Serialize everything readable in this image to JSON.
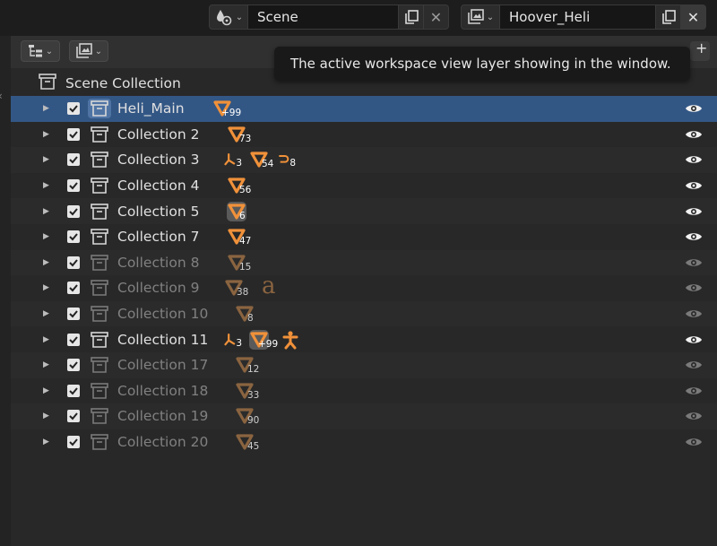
{
  "topbar": {
    "scene_name": "Scene",
    "view_layer_name": "Hoover_Heli"
  },
  "tooltip": "The active workspace view layer showing in the window.",
  "outliner": {
    "root_label": "Scene Collection",
    "rows": [
      {
        "label": "Heli_Main",
        "selected": true,
        "dim": false,
        "content": [
          {
            "type": "mesh",
            "count": "+99"
          }
        ]
      },
      {
        "label": "Collection 2",
        "selected": false,
        "dim": false,
        "content": [
          {
            "type": "mesh",
            "count": "73"
          }
        ]
      },
      {
        "label": "Collection 3",
        "selected": false,
        "dim": false,
        "content": [
          {
            "type": "bone",
            "count": "3"
          },
          {
            "type": "mesh",
            "count": "54"
          },
          {
            "type": "curve",
            "count": "8"
          }
        ]
      },
      {
        "label": "Collection 4",
        "selected": false,
        "dim": false,
        "content": [
          {
            "type": "mesh",
            "count": "56"
          }
        ]
      },
      {
        "label": "Collection 5",
        "selected": false,
        "dim": false,
        "content": [
          {
            "type": "mesh",
            "count": "6",
            "highlight": true
          }
        ]
      },
      {
        "label": "Collection 7",
        "selected": false,
        "dim": false,
        "content": [
          {
            "type": "mesh",
            "count": "47"
          }
        ]
      },
      {
        "label": "Collection 8",
        "selected": false,
        "dim": true,
        "content": [
          {
            "type": "mesh",
            "count": "15"
          }
        ]
      },
      {
        "label": "Collection 9",
        "selected": false,
        "dim": true,
        "content": [
          {
            "type": "mesh",
            "count": "38"
          },
          {
            "type": "font",
            "count": ""
          }
        ]
      },
      {
        "label": "Collection 10",
        "selected": false,
        "dim": true,
        "content": [
          {
            "type": "mesh",
            "count": "8"
          }
        ]
      },
      {
        "label": "Collection 11",
        "selected": false,
        "dim": false,
        "content": [
          {
            "type": "bone",
            "count": "3"
          },
          {
            "type": "mesh",
            "count": "+99",
            "highlight": true
          },
          {
            "type": "armature",
            "count": ""
          }
        ]
      },
      {
        "label": "Collection 17",
        "selected": false,
        "dim": true,
        "content": [
          {
            "type": "mesh",
            "count": "12"
          }
        ]
      },
      {
        "label": "Collection 18",
        "selected": false,
        "dim": true,
        "content": [
          {
            "type": "mesh",
            "count": "33"
          }
        ]
      },
      {
        "label": "Collection 19",
        "selected": false,
        "dim": true,
        "content": [
          {
            "type": "mesh",
            "count": "90"
          }
        ]
      },
      {
        "label": "Collection 20",
        "selected": false,
        "dim": true,
        "content": [
          {
            "type": "mesh",
            "count": "45"
          }
        ]
      }
    ]
  },
  "colors": {
    "accent_orange": "#f0913a",
    "dim_orange": "#8a6440",
    "selected_row": "#335785",
    "eye_on": "#f2f2f2",
    "eye_off": "#7a7a7a"
  },
  "icons": [
    "scene-icon",
    "view-layer-icon",
    "copy-icon",
    "close-icon",
    "display-mode-icon",
    "filter-icon",
    "collection-icon",
    "checkbox-icon",
    "eye-icon",
    "mesh-icon",
    "bone-icon",
    "curve-icon",
    "font-icon",
    "armature-icon",
    "expand-arrow-icon"
  ]
}
